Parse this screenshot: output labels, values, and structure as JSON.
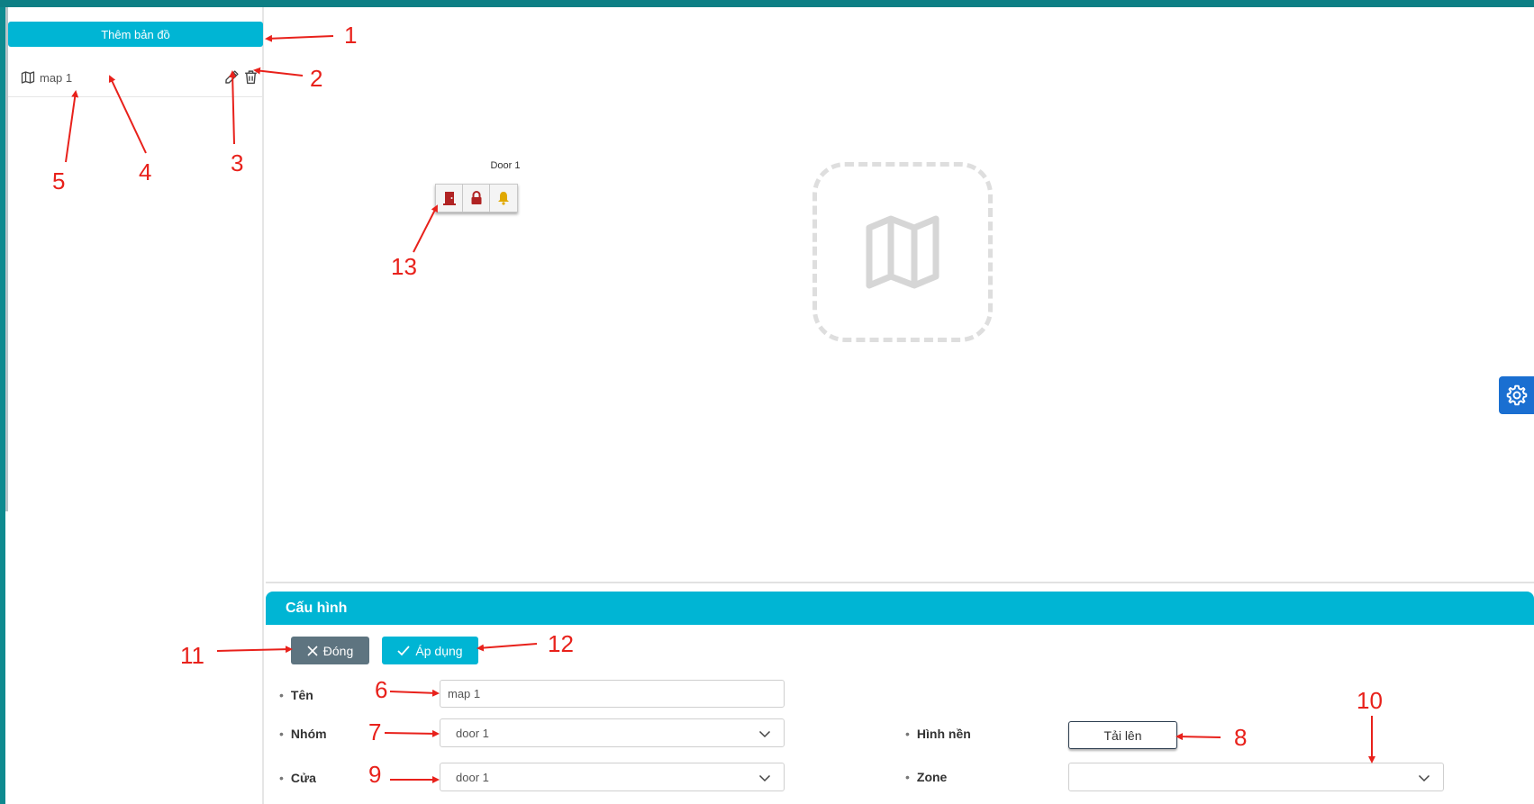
{
  "sidebar": {
    "add_map_label": "Thêm bản đồ",
    "maps": [
      {
        "name": "map 1"
      }
    ]
  },
  "canvas": {
    "door": {
      "label": "Door 1",
      "buttons": [
        "door-open-icon",
        "lock-icon",
        "bell-icon"
      ]
    },
    "placeholder_icon": "map-icon"
  },
  "config": {
    "title": "Cấu hình",
    "close_label": "Đóng",
    "apply_label": "Áp dụng",
    "fields": {
      "name_label": "Tên",
      "name_value": "map 1",
      "group_label": "Nhóm",
      "group_value": "door 1",
      "door_label": "Cửa",
      "door_value": "door 1",
      "background_label": "Hình nền",
      "upload_label": "Tải lên",
      "zone_label": "Zone",
      "zone_value": ""
    }
  },
  "annotations": [
    "1",
    "2",
    "3",
    "4",
    "5",
    "6",
    "7",
    "8",
    "9",
    "10",
    "11",
    "12",
    "13"
  ],
  "colors": {
    "primary": "#00b5d4",
    "close_button": "#5e7480",
    "gear_button": "#1a6fd1",
    "door_icon": "#b02323",
    "bell_icon": "#e0a800",
    "annotation": "#e8211b"
  }
}
